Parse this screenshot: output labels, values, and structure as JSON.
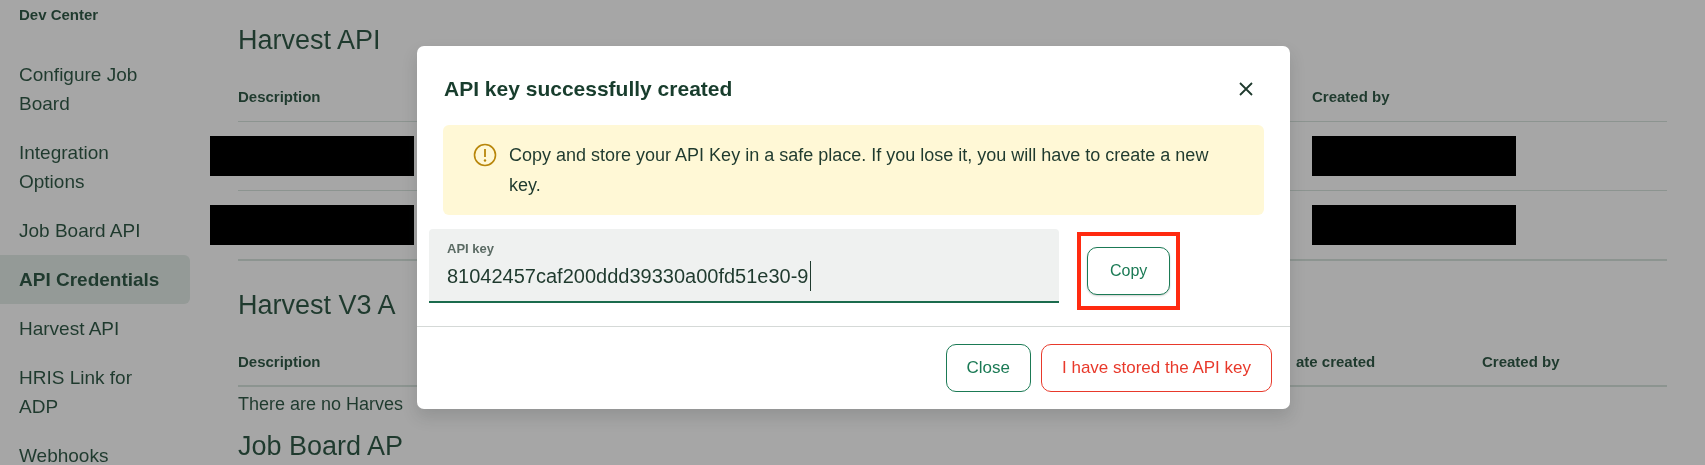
{
  "sidebar": {
    "title": "Dev Center",
    "items": [
      {
        "label": "Configure Job Board",
        "selected": false
      },
      {
        "label": "Integration Options",
        "selected": false
      },
      {
        "label": "Job Board API",
        "selected": false
      },
      {
        "label": "API Credentials",
        "selected": true
      },
      {
        "label": "Harvest API",
        "selected": false
      },
      {
        "label": "HRIS Link for ADP",
        "selected": false
      },
      {
        "label": "Webhooks",
        "selected": false
      }
    ]
  },
  "sections": [
    {
      "heading": "Harvest API",
      "columns": [
        "Description",
        "Created by"
      ],
      "rows": [
        {
          "cells": [
            {
              "redacted": true
            },
            {
              "redacted": true
            }
          ]
        },
        {
          "cells": [
            {
              "redacted": true
            },
            {
              "redacted": true
            }
          ]
        }
      ]
    },
    {
      "heading": "Harvest V3 A",
      "columns": [
        "Description",
        "ate created",
        "Created by"
      ],
      "empty_message": "There are no Harves"
    },
    {
      "heading": "Job Board AP"
    }
  ],
  "modal": {
    "title": "API key successfully created",
    "alert": "Copy and store your API Key in a safe place. If you lose it, you will have to create a new key.",
    "field": {
      "label": "API key",
      "value": "81042457caf200ddd39330a00fd51e30-9"
    },
    "copy_button": {
      "label": "Copy",
      "highlighted": true
    },
    "buttons": [
      {
        "label": "Close",
        "kind": "secondary"
      },
      {
        "label": "I have stored the API key",
        "kind": "danger"
      }
    ]
  }
}
